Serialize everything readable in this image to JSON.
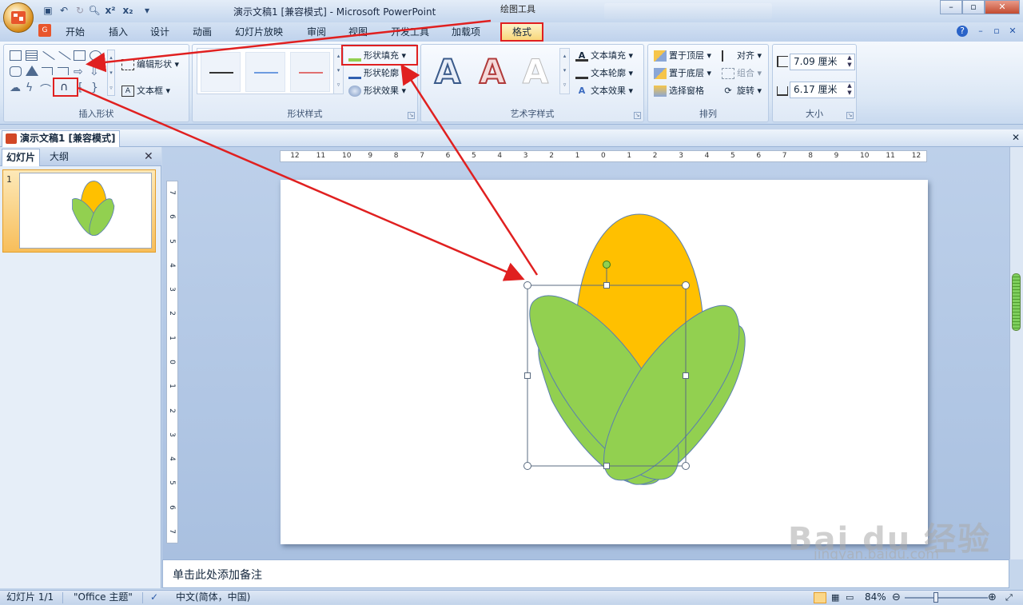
{
  "window": {
    "title": "演示文稿1 [兼容模式] - Microsoft PowerPoint",
    "contextual_group": "绘图工具",
    "controls": [
      "–",
      "▫",
      "✕"
    ]
  },
  "quick_access": [
    "save-icon",
    "undo-icon",
    "redo-icon",
    "print-preview-icon",
    "superscript-icon",
    "subscript-icon",
    "customize-icon"
  ],
  "tabs": [
    "开始",
    "插入",
    "设计",
    "动画",
    "幻灯片放映",
    "审阅",
    "视图",
    "开发工具",
    "加载项",
    "格式"
  ],
  "active_tab": "格式",
  "ribbon": {
    "insert_shapes": {
      "label": "插入形状",
      "edit_shape": "编辑形状",
      "text_box": "文本框"
    },
    "shape_styles": {
      "label": "形状样式",
      "fill": "形状填充",
      "outline": "形状轮廓",
      "effects": "形状效果"
    },
    "wordart_styles": {
      "label": "艺术字样式",
      "text_fill": "文本填充",
      "text_outline": "文本轮廓",
      "text_effects": "文本效果",
      "sample": "A"
    },
    "arrange": {
      "label": "排列",
      "bring_front": "置于顶层",
      "send_back": "置于底层",
      "selection_pane": "选择窗格",
      "align": "对齐",
      "group": "组合",
      "rotate": "旋转"
    },
    "size": {
      "label": "大小",
      "height": "7.09 厘米",
      "width": "6.17 厘米"
    }
  },
  "document_tab": "演示文稿1 [兼容模式]",
  "left_pane": {
    "tabs": [
      "幻灯片",
      "大纲"
    ],
    "slide_number": "1",
    "close": "✕"
  },
  "ruler": {
    "horizontal": [
      "12",
      "11",
      "10",
      "9",
      "8",
      "7",
      "6",
      "5",
      "4",
      "3",
      "2",
      "1",
      "0",
      "1",
      "2",
      "3",
      "4",
      "5",
      "6",
      "7",
      "8",
      "9",
      "10",
      "11",
      "12"
    ],
    "vertical": [
      "7",
      "6",
      "5",
      "4",
      "3",
      "2",
      "1",
      "0",
      "1",
      "2",
      "3",
      "4",
      "5",
      "6",
      "7"
    ]
  },
  "notes_placeholder": "单击此处添加备注",
  "status": {
    "slide": "幻灯片 1/1",
    "theme": "\"Office 主题\"",
    "language": "中文(简体，中国)",
    "zoom": "84%"
  },
  "watermark": {
    "brand": "Bai du 经验",
    "url": "jingyan.baidu.com"
  },
  "colors": {
    "accent_red": "#e02020",
    "corn_yellow": "#ffc000",
    "leaf_green": "#92d050",
    "shape_outline": "#5a7fb0"
  }
}
